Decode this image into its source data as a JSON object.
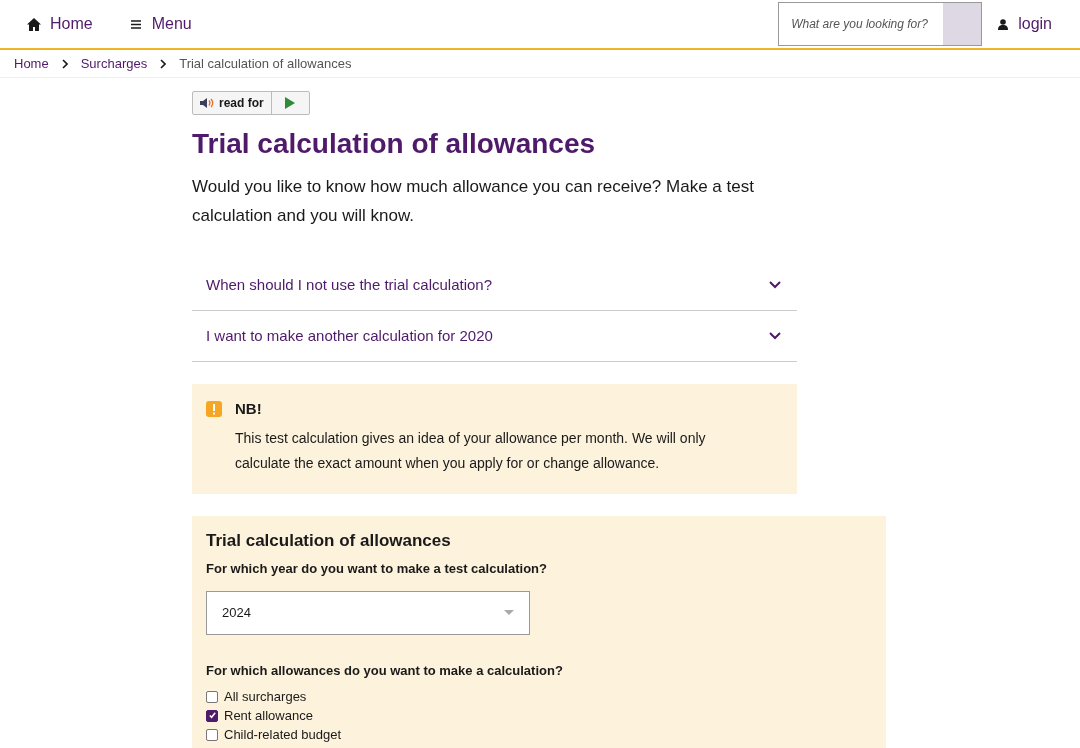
{
  "header": {
    "home": "Home",
    "menu": "Menu",
    "search": {
      "placeholder": "What are you looking for?"
    },
    "login": "login"
  },
  "breadcrumb": [
    {
      "label": "Home",
      "kind": "link"
    },
    {
      "label": "Surcharges",
      "kind": "link"
    },
    {
      "label": "Trial calculation of allowances",
      "kind": "current"
    }
  ],
  "read_for": {
    "label": "read for"
  },
  "title": "Trial calculation of allowances",
  "intro": "Would you like to know how much allowance you can receive? Make a test calculation and you will know.",
  "accordions": [
    {
      "label": "When should I not use the trial calculation?",
      "expanded": false
    },
    {
      "label": "I want to make another calculation for 2020",
      "expanded": false
    }
  ],
  "notice": {
    "title": "NB!",
    "text": "This test calculation gives an idea of your allowance per month. We will only calculate the exact amount when you apply for or change allowance."
  },
  "form": {
    "title": "Trial calculation of allowances",
    "year_question": "For which year do you want to make a test calculation?",
    "year": "2024",
    "allowance_question": "For which allowances do you want to make a calculation?",
    "options": [
      {
        "label": "All surcharges",
        "checked": false
      },
      {
        "label": "Rent allowance",
        "checked": true
      },
      {
        "label": "Child-related budget",
        "checked": false
      }
    ]
  }
}
